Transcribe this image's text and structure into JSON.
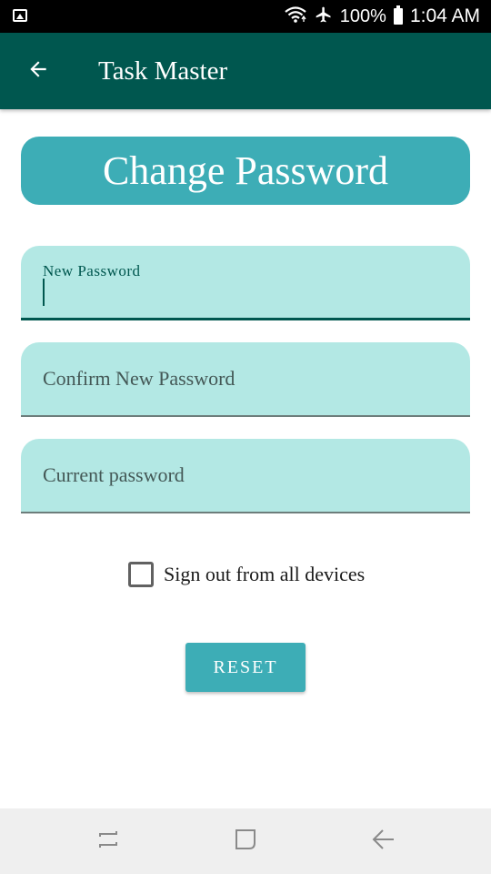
{
  "status_bar": {
    "battery_percent": "100%",
    "time": "1:04 AM",
    "icons": [
      "image-notification-icon",
      "wifi-icon",
      "airplane-mode-icon",
      "battery-icon"
    ]
  },
  "app_bar": {
    "title": "Task Master",
    "back_icon": "arrow-left-icon"
  },
  "header": {
    "title": "Change Password"
  },
  "fields": {
    "new_password": {
      "label": "New Password",
      "value": ""
    },
    "confirm_new_password": {
      "placeholder": "Confirm New Password",
      "value": ""
    },
    "current_password": {
      "placeholder": "Current password",
      "value": ""
    }
  },
  "sign_out_all": {
    "label": "Sign out from all devices",
    "checked": false
  },
  "reset_button": {
    "label": "RESET"
  },
  "nav_bar": {
    "items": [
      "recents-icon",
      "home-icon",
      "back-icon"
    ]
  },
  "colors": {
    "app_bar": "#00574f",
    "accent": "#3dadb6",
    "field_bg": "#b3e8e4",
    "status_bar": "#000000",
    "nav_bar": "#efefef"
  }
}
